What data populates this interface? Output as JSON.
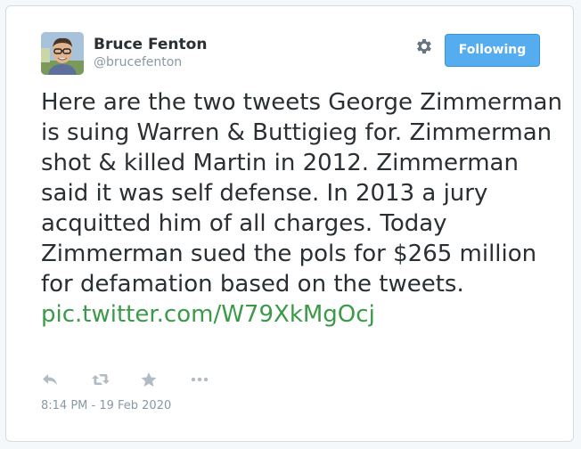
{
  "author": {
    "name": "Bruce Fenton",
    "handle": "@brucefenton",
    "avatar": "profile-photo"
  },
  "header": {
    "settings_icon": "gear-icon",
    "follow_button_label": "Following"
  },
  "tweet": {
    "text": "Here are the two tweets George Zimmerman is suing Warren & Buttigieg for. Zimmerman shot & killed Martin in 2012. Zimmerman said it was self defense. In 2013 a jury acquitted him of all charges. Today Zimmerman sued the pols for $265 million for defamation based on the tweets. ",
    "link": "pic.twitter.com/W79XkMgOcj",
    "timestamp": "8:14 PM - 19 Feb 2020"
  },
  "actions": [
    {
      "icon": "reply-icon"
    },
    {
      "icon": "retweet-icon"
    },
    {
      "icon": "favorite-star-icon"
    },
    {
      "icon": "more-dots-icon"
    }
  ],
  "colors": {
    "follow_button": "#55acee",
    "link": "#3b9a48",
    "text": "#292f33",
    "muted": "#8899a6"
  }
}
